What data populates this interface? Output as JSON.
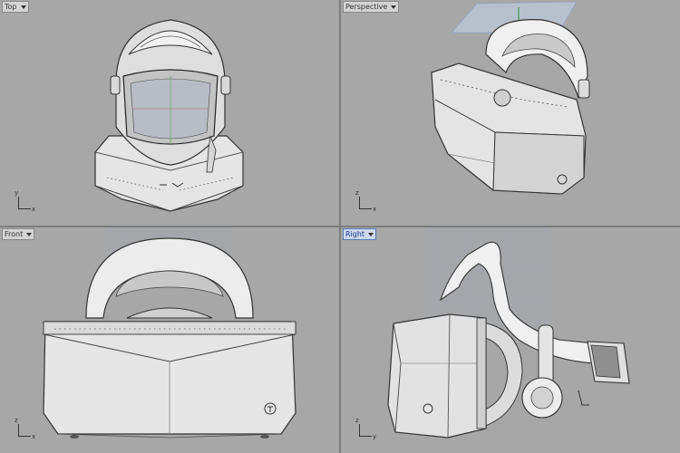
{
  "viewports": {
    "top": {
      "label": "Top",
      "axis_v": "y",
      "axis_h": "x"
    },
    "perspective": {
      "label": "Perspective",
      "axis_v": "z",
      "axis_h": "x"
    },
    "front": {
      "label": "Front",
      "axis_v": "z",
      "axis_h": "x"
    },
    "right": {
      "label": "Right",
      "axis_v": "z",
      "axis_h": "y",
      "active": true
    }
  },
  "colors": {
    "viewport_bg": "#a7a7a7",
    "active_tab": "#cbd8ee",
    "model_light": "#ececec",
    "model_mid": "#cfcfcf",
    "model_dark": "#8c8c8c",
    "grid": "#8fa3c9"
  }
}
